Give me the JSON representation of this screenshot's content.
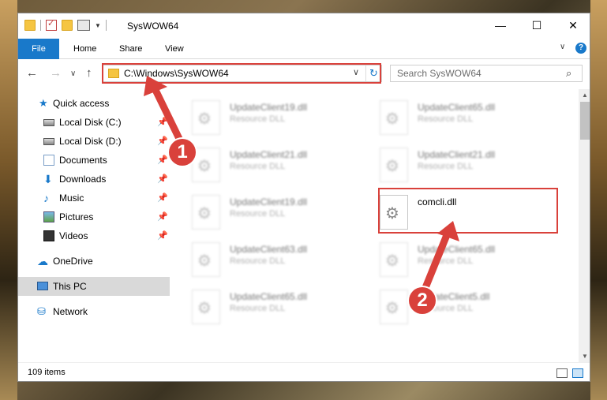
{
  "window": {
    "title": "SysWOW64",
    "minimize": "—",
    "maximize": "☐",
    "close": "✕"
  },
  "ribbon": {
    "file": "File",
    "tabs": [
      "Home",
      "Share",
      "View"
    ],
    "help": "?"
  },
  "nav": {
    "back": "←",
    "forward": "→",
    "recent": "∨",
    "up": "↑",
    "address": "C:\\Windows\\SysWOW64",
    "search_placeholder": "Search SysWOW64"
  },
  "sidebar": {
    "items": [
      {
        "label": "Quick access",
        "icon": "star-icon",
        "pinned": false
      },
      {
        "label": "Local Disk (C:)",
        "icon": "disk-icon",
        "pinned": true
      },
      {
        "label": "Local Disk (D:)",
        "icon": "disk-icon",
        "pinned": true
      },
      {
        "label": "Documents",
        "icon": "documents-icon",
        "pinned": true
      },
      {
        "label": "Downloads",
        "icon": "downloads-icon",
        "pinned": true
      },
      {
        "label": "Music",
        "icon": "music-icon",
        "pinned": true
      },
      {
        "label": "Pictures",
        "icon": "pictures-icon",
        "pinned": true
      },
      {
        "label": "Videos",
        "icon": "videos-icon",
        "pinned": true
      },
      {
        "label": "OneDrive",
        "icon": "onedrive-icon",
        "pinned": false
      },
      {
        "label": "This PC",
        "icon": "this-pc-icon",
        "pinned": false,
        "selected": true
      },
      {
        "label": "Network",
        "icon": "network-icon",
        "pinned": false
      }
    ]
  },
  "files": [
    {
      "name": "UpdateClient19.dll",
      "type": "Resource DLL",
      "blurred": true
    },
    {
      "name": "UpdateClient65.dll",
      "type": "Resource DLL",
      "blurred": true
    },
    {
      "name": "UpdateClient21.dll",
      "type": "Resource DLL",
      "blurred": true
    },
    {
      "name": "UpdateClient21.dll",
      "type": "Resource DLL",
      "blurred": true
    },
    {
      "name": "UpdateClient19.dll",
      "type": "Resource DLL",
      "blurred": true
    },
    {
      "name": "comcli.dll",
      "type": "",
      "blurred": false
    },
    {
      "name": "UpdateClient63.dll",
      "type": "Resource DLL",
      "blurred": true
    },
    {
      "name": "UpdateClient65.dll",
      "type": "Resource DLL",
      "blurred": true
    },
    {
      "name": "UpdateClient65.dll",
      "type": "Resource DLL",
      "blurred": true
    },
    {
      "name": "UpdateClient5.dll",
      "type": "Resource DLL",
      "blurred": true
    }
  ],
  "status": {
    "item_count": "109 items"
  },
  "annotations": {
    "step1": "1",
    "step2": "2",
    "color": "#d9413b"
  }
}
